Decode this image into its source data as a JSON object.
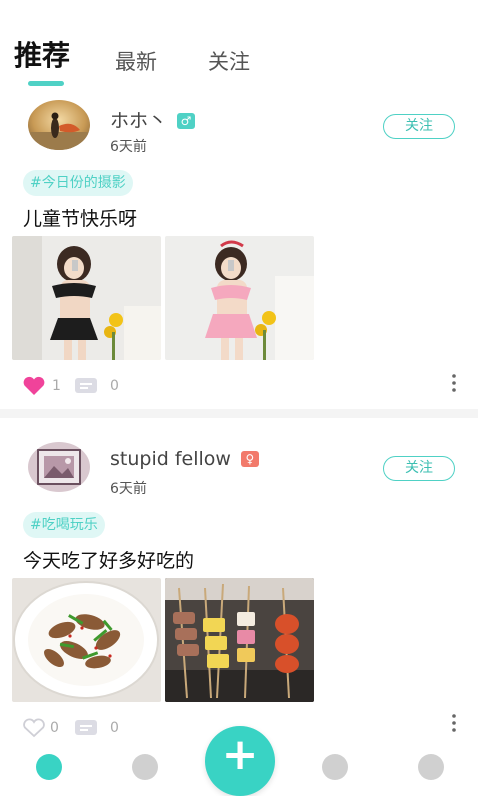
{
  "tabs": [
    {
      "label": "推荐",
      "active": true
    },
    {
      "label": "最新",
      "active": false
    },
    {
      "label": "关注",
      "active": false
    }
  ],
  "colors": {
    "accent": "#4fd1c5",
    "like_active": "#f0439a",
    "male_badge": "#4fd1c5",
    "female_badge": "#f27a6b"
  },
  "posts": [
    {
      "username": "ホホ丶",
      "gender": "male",
      "gender_icon": "♂",
      "time": "6天前",
      "follow_label": "关注",
      "topic": "#今日份的摄影",
      "text": "儿童节快乐呀",
      "likes": "1",
      "liked": true,
      "comments": "0",
      "images": [
        "photo-dress-black",
        "photo-dress-pink"
      ]
    },
    {
      "username": "stupid fellow",
      "gender": "female",
      "gender_icon": "♀",
      "time": "6天前",
      "follow_label": "关注",
      "topic": "#吃喝玩乐",
      "text": "今天吃了好多好吃的",
      "likes": "0",
      "liked": false,
      "comments": "0",
      "images": [
        "photo-stir-fry",
        "photo-skewers"
      ]
    }
  ],
  "fab": {
    "icon": "plus-icon",
    "label": "+"
  }
}
